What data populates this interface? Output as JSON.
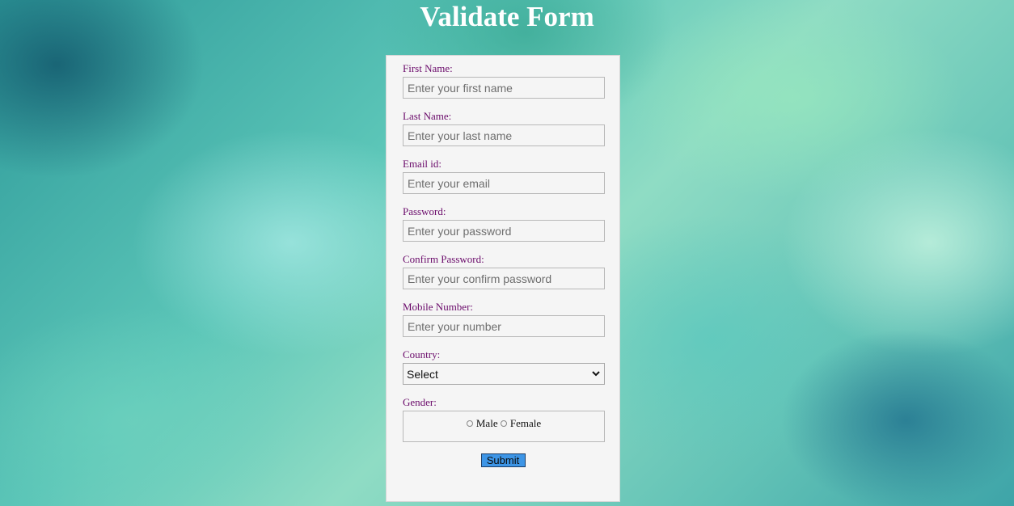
{
  "page": {
    "title": "Validate Form"
  },
  "form": {
    "fields": [
      {
        "label": "First Name:",
        "placeholder": "Enter your first name",
        "value": ""
      },
      {
        "label": "Last Name:",
        "placeholder": "Enter your last name",
        "value": ""
      },
      {
        "label": "Email id:",
        "placeholder": "Enter your email",
        "value": ""
      },
      {
        "label": "Password:",
        "placeholder": "Enter your password",
        "value": ""
      },
      {
        "label": "Confirm Password:",
        "placeholder": "Enter your confirm password",
        "value": ""
      },
      {
        "label": "Mobile Number:",
        "placeholder": "Enter your number",
        "value": ""
      }
    ],
    "country": {
      "label": "Country:",
      "selected": "Select"
    },
    "gender": {
      "label": "Gender:",
      "options": [
        {
          "label": "Male",
          "checked": false
        },
        {
          "label": "Female",
          "checked": false
        }
      ]
    },
    "submit_label": "Submit"
  },
  "icons": {
    "select_arrow": "chevron-down-icon",
    "radio": "radio-unchecked-icon"
  },
  "colors": {
    "label_text": "#6a0a6a",
    "submit_bg": "#3d95e6",
    "card_bg": "#f5f5f5",
    "title_text": "#ffffff"
  }
}
